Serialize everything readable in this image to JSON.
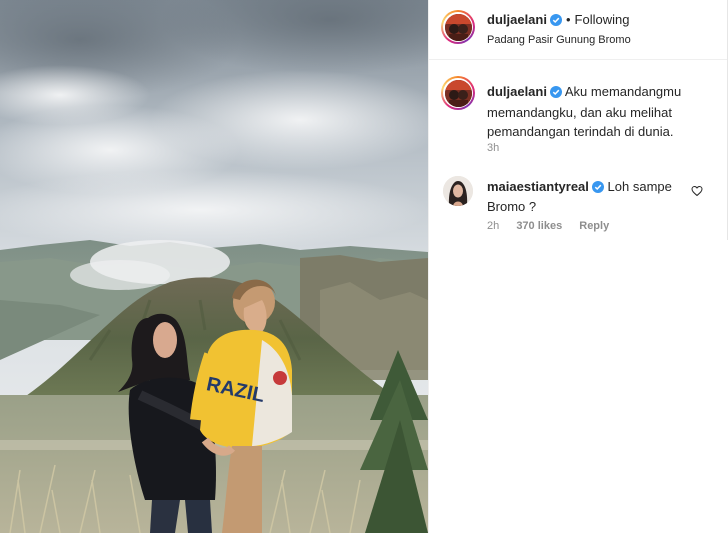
{
  "post": {
    "author": {
      "username": "duljaelani",
      "verified": true,
      "follow_state": "Following",
      "separator": "•",
      "location": "Padang Pasir Gunung Bromo"
    },
    "caption": {
      "username": "duljaelani",
      "text": "Aku memandangmu memandangku, dan aku melihat pemandangan terindah di dunia.",
      "time": "3h"
    },
    "comments": [
      {
        "username": "maiaestiantyreal",
        "verified": true,
        "text": "Loh sampe Bromo ?",
        "time": "2h",
        "likes": "370 likes",
        "reply_label": "Reply"
      }
    ],
    "photo_text": "RAZIL"
  },
  "colors": {
    "text_primary": "#262626",
    "text_secondary": "#8e8e8e",
    "verified_blue": "#3897f0",
    "story_ring": [
      "#f58529",
      "#dd2a7b",
      "#8134af",
      "#feda77"
    ]
  },
  "icons": [
    "verified-badge-icon",
    "heart-icon",
    "more-options-icon"
  ]
}
